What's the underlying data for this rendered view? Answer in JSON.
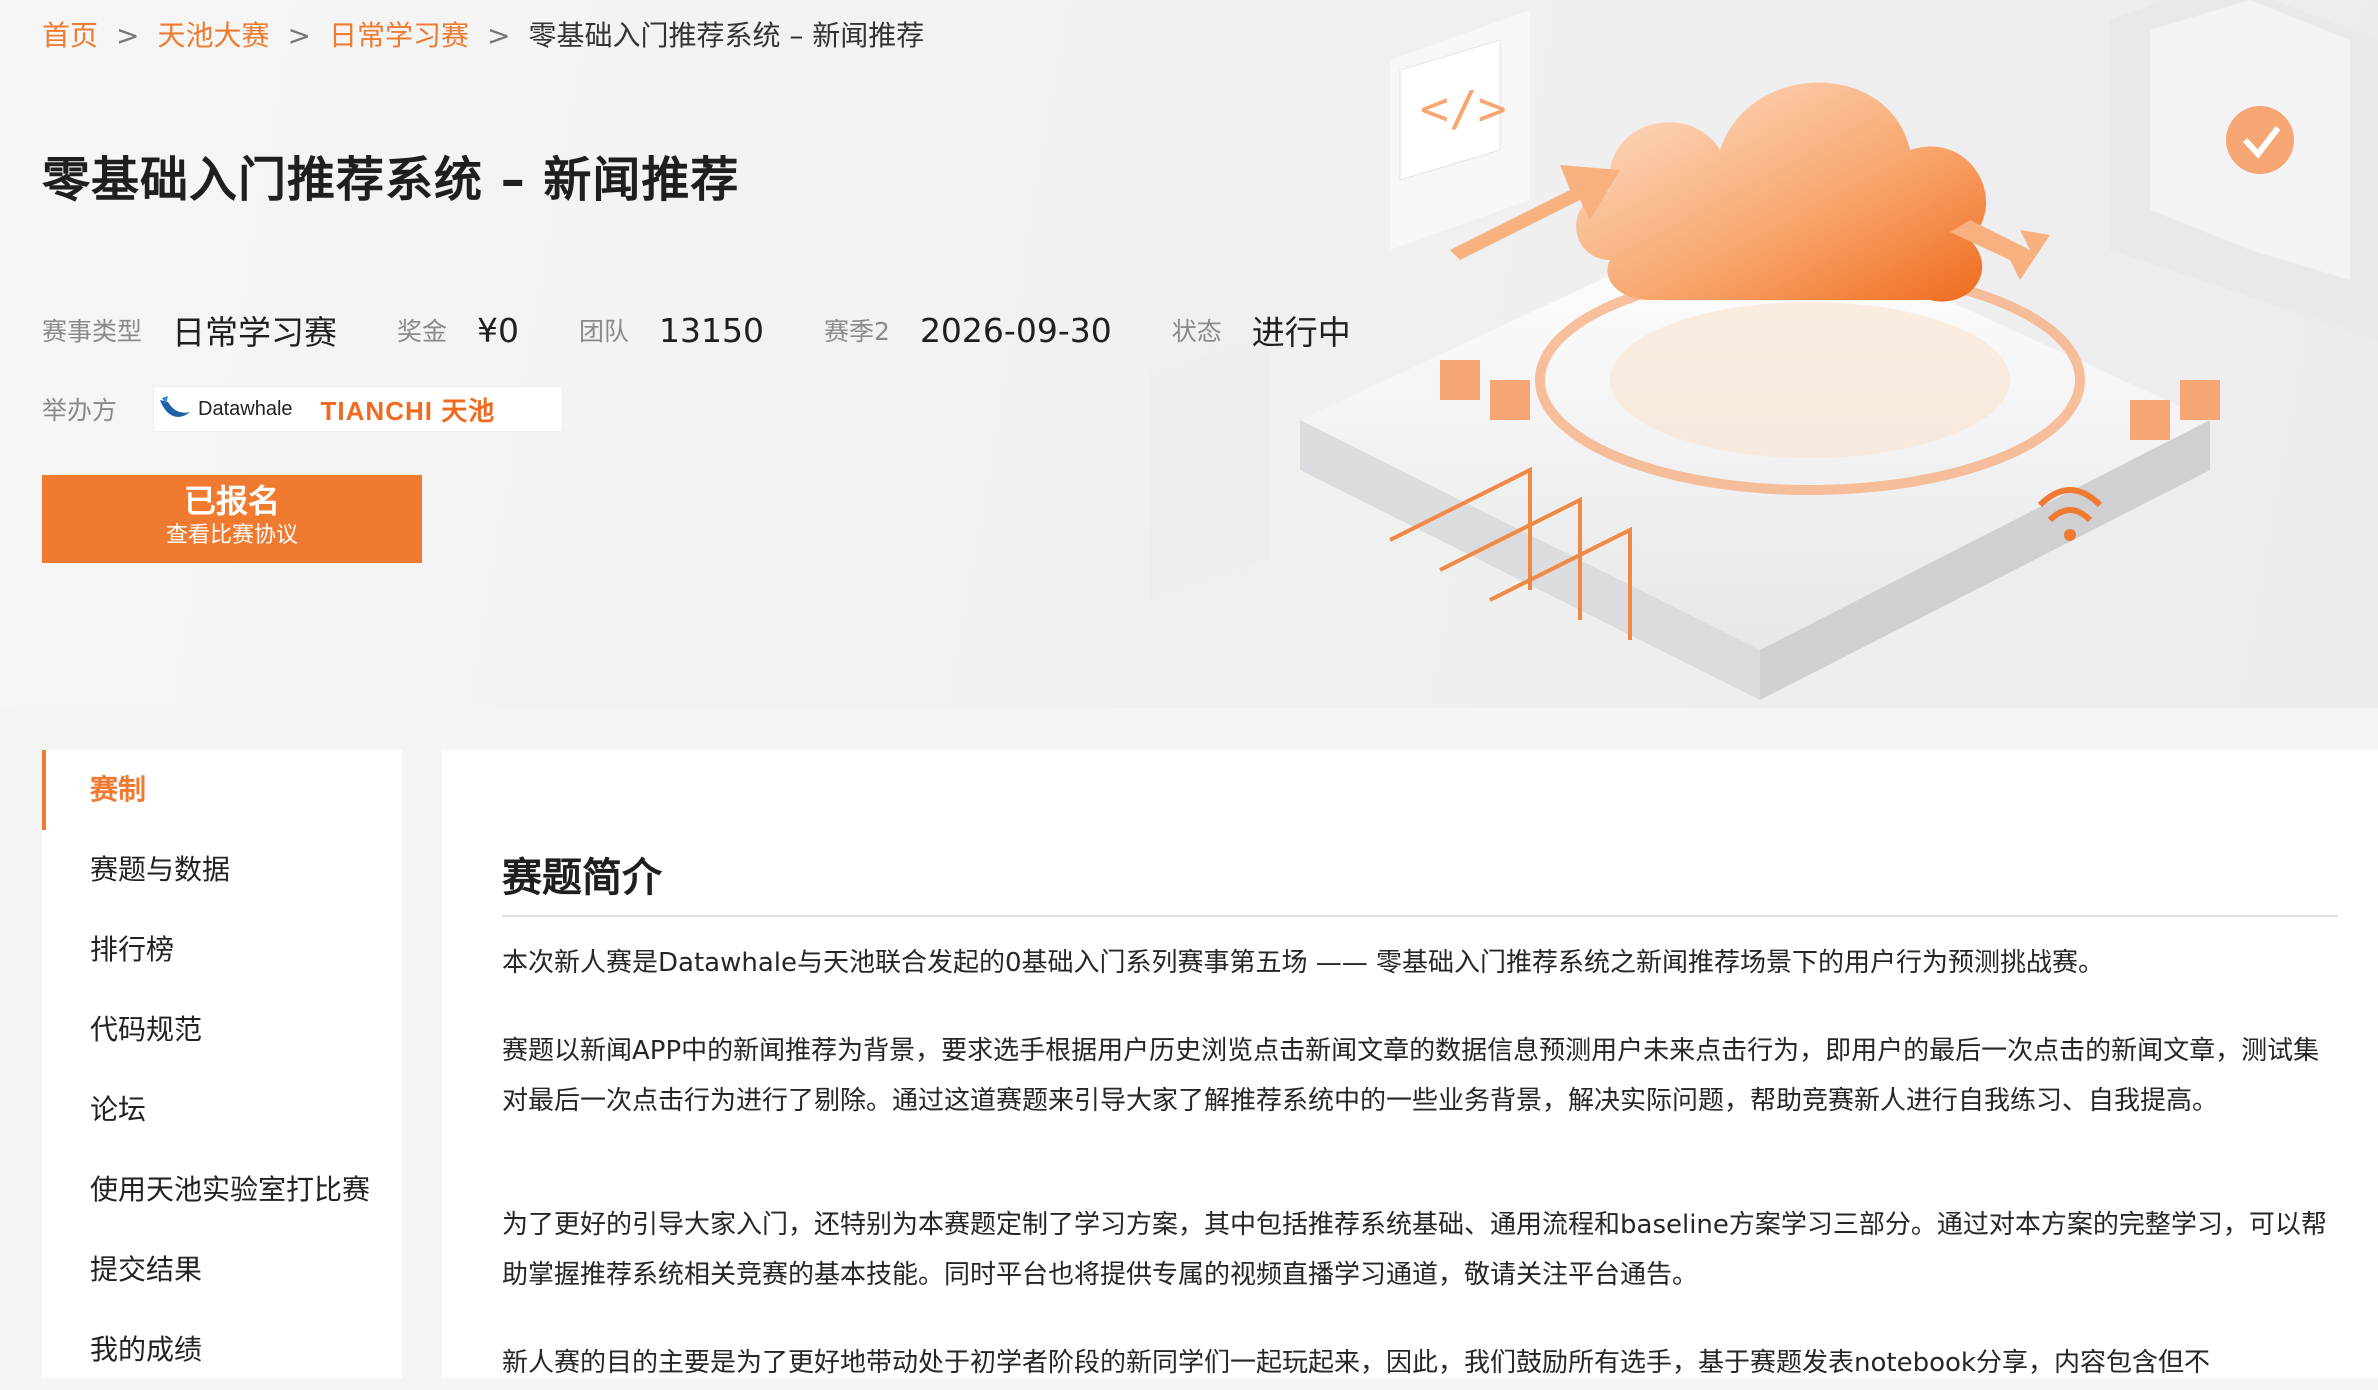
{
  "breadcrumb": {
    "home": "首页",
    "tianchi": "天池大赛",
    "daily": "日常学习赛",
    "current": "零基础入门推荐系统 – 新闻推荐",
    "separator": ">"
  },
  "header": {
    "title": "零基础入门推荐系统 – 新闻推荐"
  },
  "meta": {
    "type_label": "赛事类型",
    "type_value": "日常学习赛",
    "prize_label": "奖金",
    "prize_value": "¥0",
    "team_label": "团队",
    "team_value": "13150",
    "season_label": "赛季2",
    "season_value": "2026-09-30",
    "status_label": "状态",
    "status_value": "进行中"
  },
  "organizer": {
    "label": "举办方",
    "logo1_text": "Datawhale",
    "logo2_text": "TIANCHI 天池"
  },
  "signup": {
    "main": "已报名",
    "sub": "查看比赛协议"
  },
  "sidebar": {
    "items": [
      {
        "label": "赛制"
      },
      {
        "label": "赛题与数据"
      },
      {
        "label": "排行榜"
      },
      {
        "label": "代码规范"
      },
      {
        "label": "论坛"
      },
      {
        "label": "使用天池实验室打比赛"
      },
      {
        "label": "提交结果"
      },
      {
        "label": "我的成绩"
      }
    ]
  },
  "content": {
    "section_title": "赛题简介",
    "paragraphs": [
      "本次新人赛是Datawhale与天池联合发起的0基础入门系列赛事第五场 —— 零基础入门推荐系统之新闻推荐场景下的用户行为预测挑战赛。",
      "赛题以新闻APP中的新闻推荐为背景，要求选手根据用户历史浏览点击新闻文章的数据信息预测用户未来点击行为，即用户的最后一次点击的新闻文章，测试集对最后一次点击行为进行了剔除。通过这道赛题来引导大家了解推荐系统中的一些业务背景，解决实际问题，帮助竞赛新人进行自我练习、自我提高。",
      "为了更好的引导大家入门，还特别为本赛题定制了学习方案，其中包括推荐系统基础、通用流程和baseline方案学习三部分。通过对本方案的完整学习，可以帮助掌握推荐系统相关竞赛的基本技能。同时平台也将提供专属的视频直播学习通道，敬请关注平台通告。",
      "新人赛的目的主要是为了更好地带动处于初学者阶段的新同学们一起玩起来，因此，我们鼓励所有选手，基于赛题发表notebook分享，内容包含但不"
    ]
  },
  "colors": {
    "accent": "#ef7a30",
    "background": "#f4f4f5"
  }
}
